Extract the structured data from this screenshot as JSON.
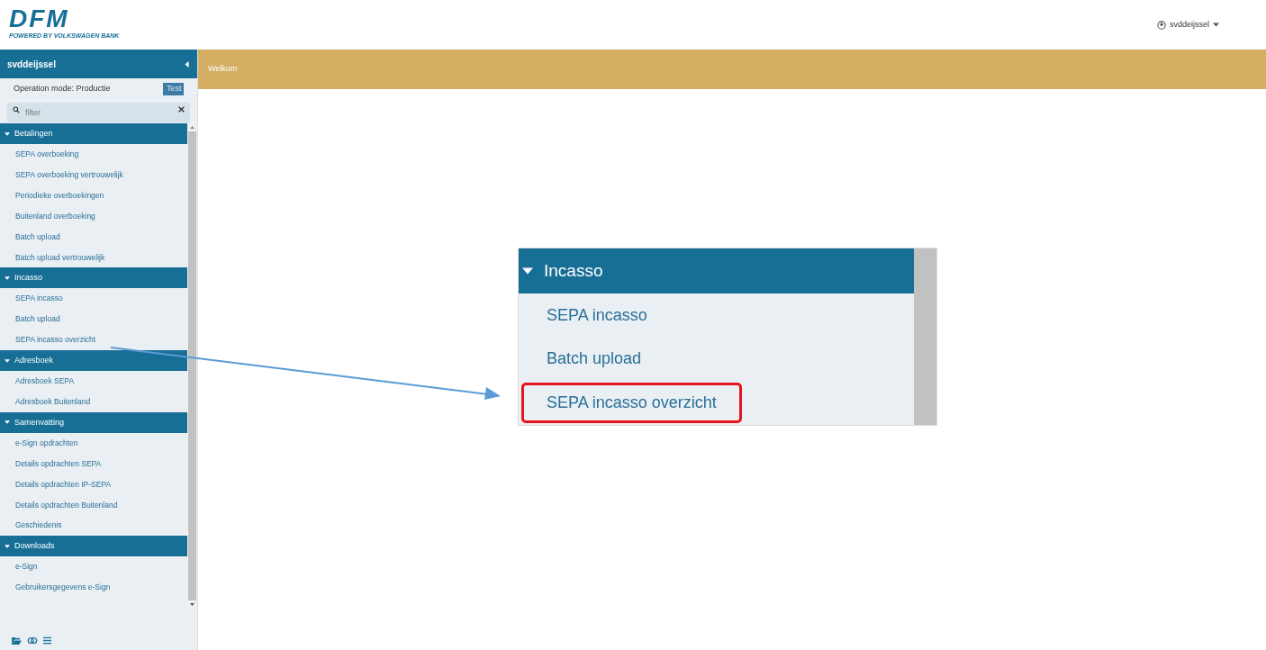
{
  "logo": {
    "title": "DFM",
    "subtitle": "POWERED BY VOLKSWAGEN BANK"
  },
  "user_menu": {
    "label": "svddeijssel"
  },
  "sidebar": {
    "user": "svddeijssel",
    "operation_mode": "Operation mode: Productie",
    "mode_button": "Test",
    "filter": {
      "placeholder": "filter"
    },
    "sections": [
      {
        "title": "Betalingen",
        "expanded": true,
        "items": [
          "SEPA overboeking",
          "SEPA overboeking vertrouwelijk",
          "Periodieke overboekingen",
          "Buitenland overboeking",
          "Batch upload",
          "Batch upload vertrouwelijk"
        ]
      },
      {
        "title": "Incasso",
        "expanded": true,
        "items": [
          "SEPA incasso",
          "Batch upload",
          "SEPA incasso overzicht"
        ]
      },
      {
        "title": "Adresboek",
        "expanded": true,
        "items": [
          "Adresboek SEPA",
          "Adresboek Buitenland"
        ]
      },
      {
        "title": "Samenvatting",
        "expanded": true,
        "items": [
          "e-Sign opdrachten",
          "Details opdrachten SEPA",
          "Details opdrachten IP-SEPA",
          "Details opdrachten Buitenland",
          "Geschiedenis"
        ]
      },
      {
        "title": "Downloads",
        "expanded": true,
        "items": [
          "e-Sign",
          "Gebruikersgegevens e-Sign"
        ]
      }
    ]
  },
  "banner": {
    "title": "Welkom"
  },
  "callout": {
    "title": "Incasso",
    "expanded": true,
    "items": [
      {
        "label": "SEPA incasso",
        "highlighted": false
      },
      {
        "label": "Batch upload",
        "highlighted": false
      },
      {
        "label": "SEPA incasso overzicht",
        "highlighted": true
      }
    ]
  }
}
